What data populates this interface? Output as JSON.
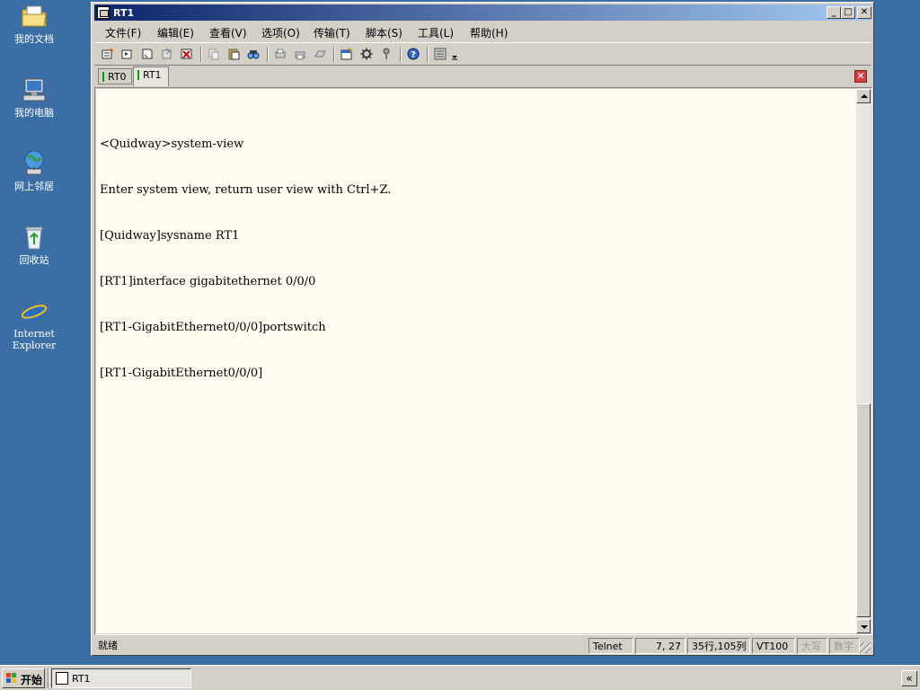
{
  "desktop": {
    "icons": [
      {
        "label": "我的文档",
        "icon": "folder-documents-icon"
      },
      {
        "label": "我的电脑",
        "icon": "computer-icon"
      },
      {
        "label": "网上邻居",
        "icon": "network-icon"
      },
      {
        "label": "回收站",
        "icon": "recycle-bin-icon"
      },
      {
        "label": "Internet Explorer",
        "icon": "internet-explorer-icon"
      }
    ]
  },
  "window": {
    "title": "RT1",
    "menu": [
      "文件(F)",
      "编辑(E)",
      "查看(V)",
      "选项(O)",
      "传输(T)",
      "脚本(S)",
      "工具(L)",
      "帮助(H)"
    ],
    "tabs": [
      {
        "label": "RT0",
        "active": false
      },
      {
        "label": "RT1",
        "active": true
      }
    ],
    "terminal": {
      "background": "#fffbf0",
      "lines": [
        "<Quidway>system-view",
        "Enter system view, return user view with Ctrl+Z.",
        "[Quidway]sysname RT1",
        "[RT1]interface gigabitethernet 0/0/0",
        "[RT1-GigabitEthernet0/0/0]portswitch",
        "[RT1-GigabitEthernet0/0/0]"
      ]
    },
    "status": {
      "ready": "就绪",
      "protocol": "Telnet",
      "cursor": "7,  27",
      "size": "35行,105列",
      "emulation": "VT100",
      "caps": "大写",
      "num": "数字"
    }
  },
  "taskbar": {
    "start": "开始",
    "task": "RT1",
    "tray_toggle": "«"
  },
  "colors": {
    "desktop": "#3a6ea5",
    "titlebar_start": "#0a246a",
    "titlebar_end": "#a6caf0",
    "window_face": "#d4d0c8"
  }
}
